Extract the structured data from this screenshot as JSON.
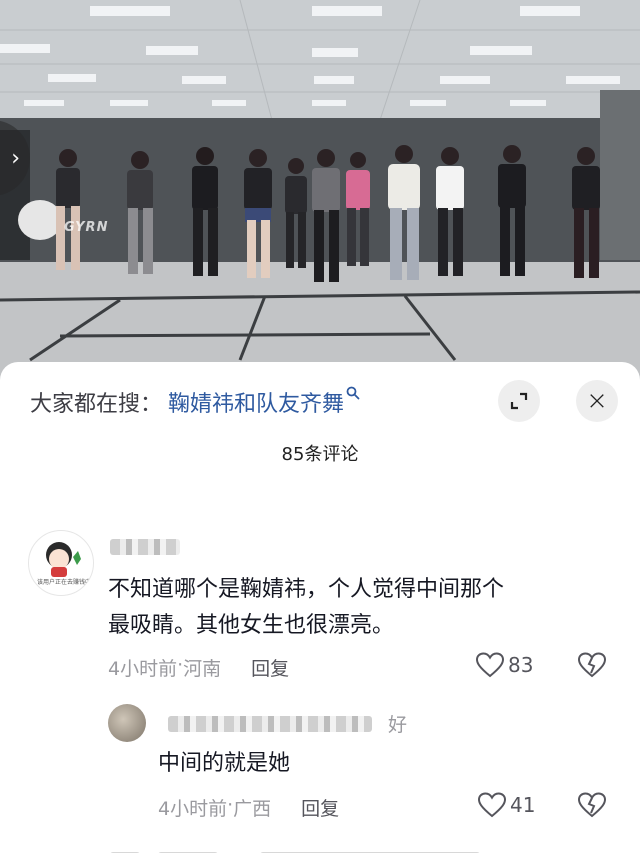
{
  "video": {
    "watermark": "GYRN",
    "side_arrow": "›"
  },
  "sheet": {
    "search_prefix": "大家都在搜：",
    "search_term": "鞠婧祎和队友齐舞",
    "search_icon": "search-icon",
    "expand_icon": "expand-icon",
    "close_icon": "close-icon",
    "close_glyph": "×",
    "comment_count": "85条评论"
  },
  "comments": [
    {
      "avatar_caption": "该用户正在去赚钱中",
      "text_line1": "不知道哪个是鞠婧祎，个人觉得中间那个",
      "text_line2": "最吸睛。其他女生也很漂亮。",
      "time": "4小时前",
      "sep": " · ",
      "location": "河南",
      "reply_label": "回复",
      "likes": "83"
    },
    {
      "name_tail": "好",
      "text": "中间的就是她",
      "time": "4小时前",
      "sep": " · ",
      "location": "广西",
      "reply_label": "回复",
      "likes": "41"
    }
  ],
  "colors": {
    "link": "#2f5aa0",
    "meta": "#9a9a9f",
    "text": "#161823"
  }
}
